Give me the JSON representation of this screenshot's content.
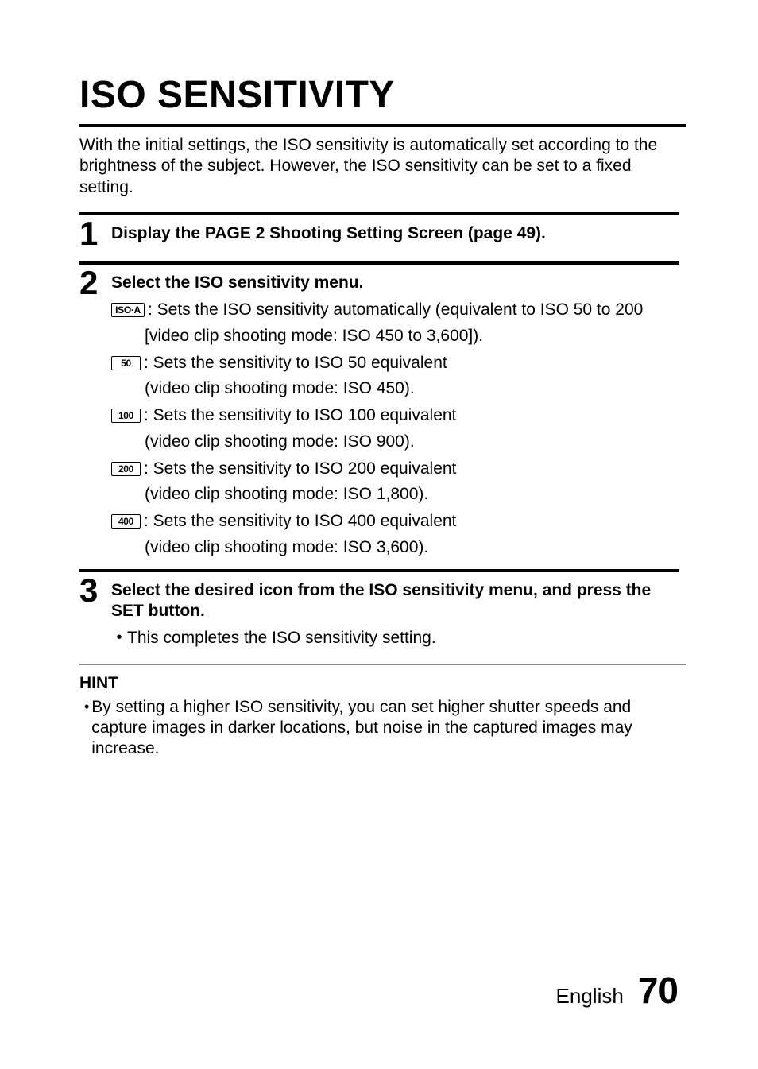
{
  "title": "ISO SENSITIVITY",
  "intro": "With the initial settings, the ISO sensitivity is automatically set according to the brightness of the subject. However, the ISO sensitivity can be set to a fixed setting.",
  "step1": {
    "num": "1",
    "lead": "Display the PAGE 2 Shooting Setting Screen (page 49)."
  },
  "step2": {
    "num": "2",
    "lead": "Select the ISO sensitivity menu.",
    "opts": {
      "isoA": {
        "icon": "ISO·A",
        "line1": ":  Sets the ISO sensitivity automatically (equivalent to ISO 50 to 200",
        "line2": "[video clip shooting mode: ISO 450 to 3,600])."
      },
      "iso50": {
        "icon": "50",
        "line1": ":  Sets the sensitivity to ISO 50 equivalent",
        "line2": "(video clip shooting mode: ISO 450)."
      },
      "iso100": {
        "icon": "100",
        "line1": ":  Sets the sensitivity to ISO 100 equivalent",
        "line2": "(video clip shooting mode: ISO 900)."
      },
      "iso200": {
        "icon": "200",
        "line1": ":  Sets the sensitivity to ISO 200 equivalent",
        "line2": "(video clip shooting mode: ISO 1,800)."
      },
      "iso400": {
        "icon": "400",
        "line1": ":  Sets the sensitivity to ISO 400 equivalent",
        "line2": "(video clip shooting mode: ISO 3,600)."
      }
    }
  },
  "step3": {
    "num": "3",
    "lead": "Select the desired icon from the ISO sensitivity menu, and press the SET button.",
    "bullet": "This completes the ISO sensitivity setting."
  },
  "hint": {
    "title": "HINT",
    "item1": "By setting a higher ISO sensitivity, you can set higher shutter speeds and capture images in darker locations, but noise in the captured images may increase."
  },
  "footer": {
    "lang": "English",
    "page": "70"
  }
}
